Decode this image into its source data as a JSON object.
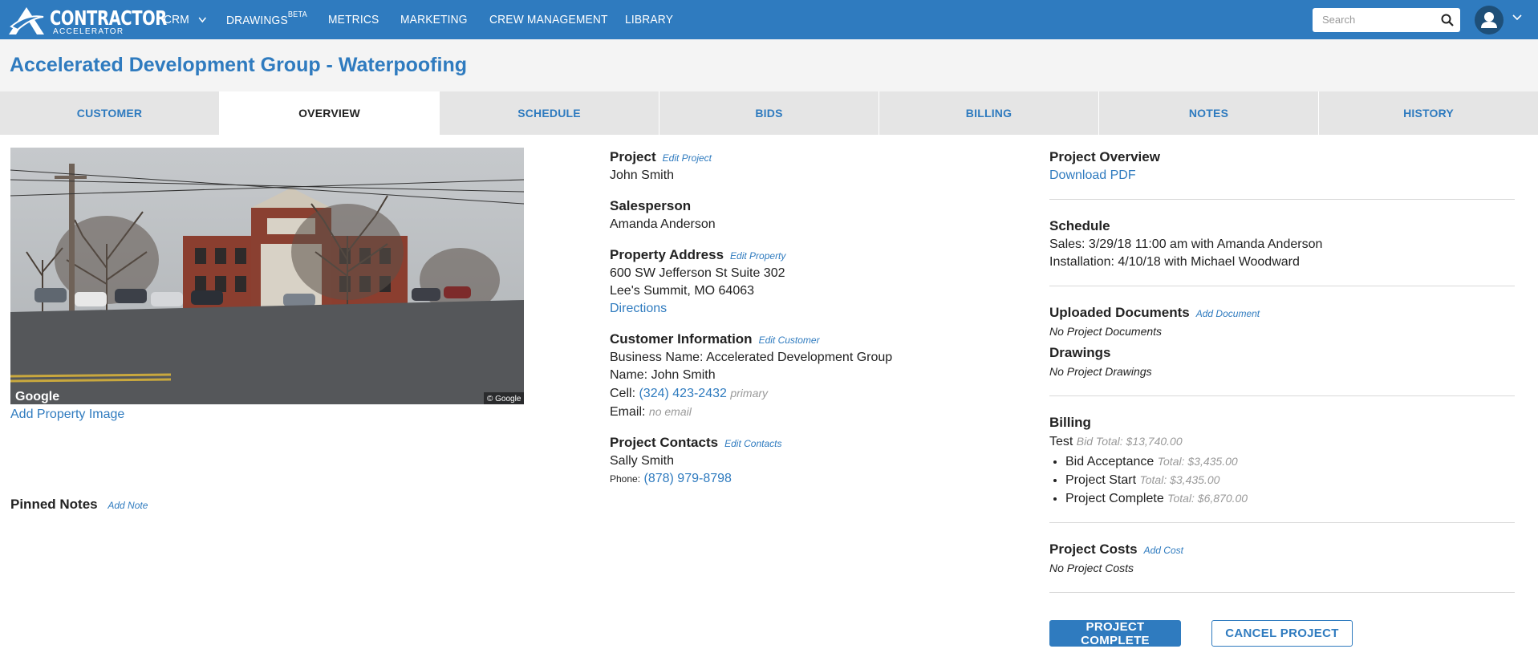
{
  "brand": {
    "name": "CONTRACTOR",
    "tagline": "ACCELERATOR"
  },
  "nav": {
    "crm": "CRM",
    "drawings": "DRAWINGS",
    "drawings_badge": "BETA",
    "metrics": "METRICS",
    "marketing": "MARKETING",
    "crew_management": "CREW MANAGEMENT",
    "library": "LIBRARY",
    "search_placeholder": "Search"
  },
  "page_title": "Accelerated Development Group - Waterpoofing",
  "tabs": [
    {
      "label": "CUSTOMER",
      "active": false
    },
    {
      "label": "OVERVIEW",
      "active": true
    },
    {
      "label": "SCHEDULE",
      "active": false
    },
    {
      "label": "BIDS",
      "active": false
    },
    {
      "label": "BILLING",
      "active": false
    },
    {
      "label": "NOTES",
      "active": false
    },
    {
      "label": "HISTORY",
      "active": false
    }
  ],
  "left": {
    "image_watermark": "Google",
    "image_copyright": "© Google",
    "add_image": "Add Property Image",
    "pinned_notes": "Pinned Notes",
    "add_note": "Add Note"
  },
  "project": {
    "heading": "Project",
    "edit": "Edit Project",
    "name": "John Smith",
    "salesperson_heading": "Salesperson",
    "salesperson": "Amanda Anderson",
    "address_heading": "Property Address",
    "edit_property": "Edit Property",
    "address_line1": "600 SW Jefferson St Suite 302",
    "address_line2": "Lee's Summit, MO 64063",
    "directions": "Directions",
    "customer_heading": "Customer Information",
    "edit_customer": "Edit Customer",
    "business_label": "Business Name:",
    "business_name": "Accelerated Development Group",
    "name_label": "Name:",
    "cell_label": "Cell:",
    "cell": "(324) 423-2432",
    "cell_tag": "primary",
    "email_label": "Email:",
    "email": "no email",
    "contacts_heading": "Project Contacts",
    "edit_contacts": "Edit Contacts",
    "contact_name": "Sally Smith",
    "contact_phone_label": "Phone:",
    "contact_phone": "(878) 979-8798"
  },
  "overview": {
    "heading": "Project Overview",
    "download": "Download PDF",
    "schedule_heading": "Schedule",
    "sales": "Sales: 3/29/18 11:00 am with Amanda Anderson",
    "installation": "Installation: 4/10/18 with Michael Woodward",
    "docs_heading": "Uploaded Documents",
    "add_document": "Add Document",
    "no_docs": "No Project Documents",
    "drawings_heading": "Drawings",
    "no_drawings": "No Project Drawings",
    "billing_heading": "Billing",
    "bid_name": "Test",
    "bid_total": "Bid Total: $13,740.00",
    "milestones": [
      {
        "name": "Bid Acceptance",
        "total": "Total: $3,435.00"
      },
      {
        "name": "Project Start",
        "total": "Total: $3,435.00"
      },
      {
        "name": "Project Complete",
        "total": "Total: $6,870.00"
      }
    ],
    "costs_heading": "Project Costs",
    "add_cost": "Add Cost",
    "no_costs": "No Project Costs"
  },
  "actions": {
    "complete": "PROJECT COMPLETE",
    "cancel": "CANCEL PROJECT"
  },
  "colors": {
    "brand": "#2f7bbf",
    "tab_bg": "#e5e5e5",
    "muted": "#999999"
  }
}
